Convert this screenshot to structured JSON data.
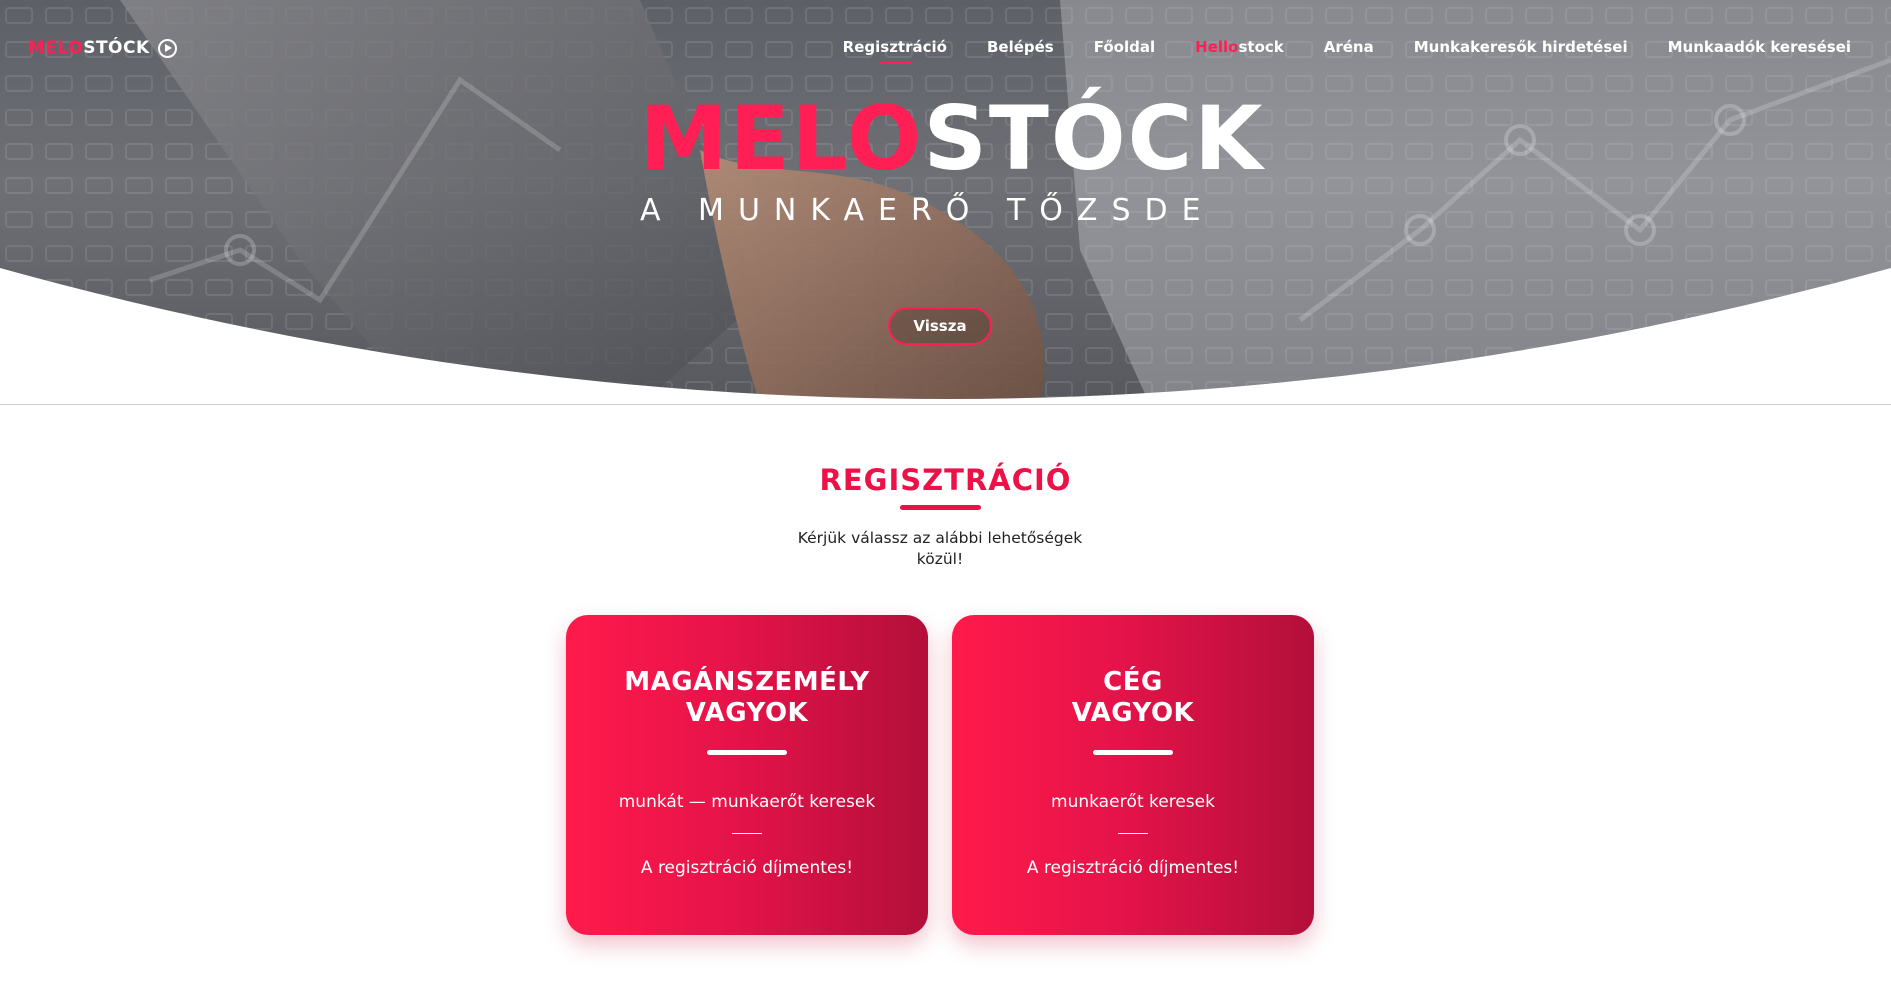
{
  "nav": {
    "logo_red": "MELO",
    "logo_white": "STÓCK",
    "items": [
      {
        "label": "Regisztráció",
        "active": true
      },
      {
        "label": "Belépés"
      },
      {
        "label": "Főoldal"
      },
      {
        "label_highlight": "Hello",
        "label_rest": "stock"
      },
      {
        "label": "Aréna"
      },
      {
        "label": "Munkakeresők hirdetései"
      },
      {
        "label": "Munkaadók keresései"
      }
    ]
  },
  "hero": {
    "logo_red": "MELO",
    "logo_white": "STÓCK",
    "tagline": "A MUNKAERŐ TŐZSDE",
    "back_button": "Vissza"
  },
  "registration": {
    "title": "REGISZTRÁCIÓ",
    "lead": "Kérjük válassz az alábbi lehetőségek közül!",
    "cards": [
      {
        "title_line1": "MAGÁNSZEMÉLY",
        "title_line2": "VAGYOK",
        "description": "munkát — munkaerőt keresek",
        "note": "A regisztráció díjmentes!"
      },
      {
        "title_line1": "CÉG",
        "title_line2": "VAGYOK",
        "description": "munkaerőt keresek",
        "note": "A regisztráció díjmentes!"
      }
    ]
  },
  "colors": {
    "brand_red": "#ff1f55",
    "title_red": "#ec1248",
    "card_gradient_start": "#ff1a4b",
    "card_gradient_end": "#b30f3a"
  }
}
